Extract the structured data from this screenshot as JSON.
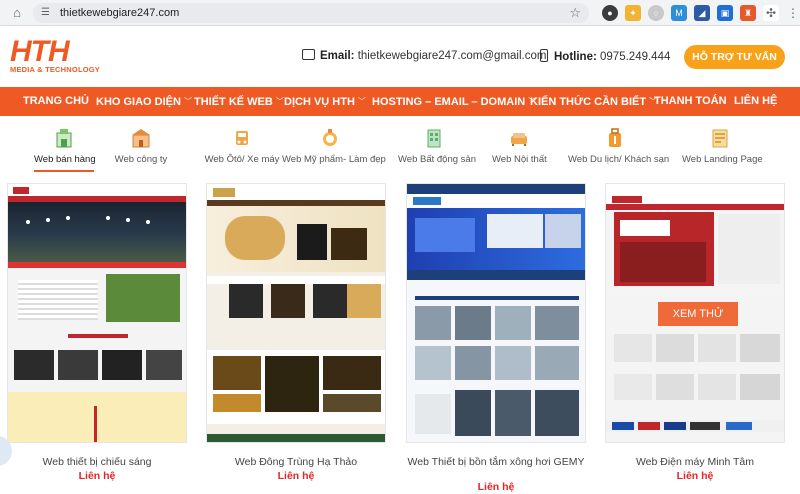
{
  "browser": {
    "url": "thietkewebgiare247.com"
  },
  "header": {
    "logo_text": "HTH",
    "logo_sub": "MEDIA & TECHNOLOGY",
    "email_label": "Email:",
    "email_value": "thietkewebgiare247.com@gmail.com",
    "hotline_label": "Hotline:",
    "hotline_value": "0975.249.444",
    "support_button": "HỖ TRỢ TƯ VẤN"
  },
  "nav": {
    "items": [
      {
        "label": "TRANG CHỦ"
      },
      {
        "label": "KHO GIAO DIỆN"
      },
      {
        "label": "THIẾT KẾ WEB"
      },
      {
        "label": "DỊCH VỤ HTH"
      },
      {
        "label": "HOSTING – EMAIL – DOMAIN"
      },
      {
        "label": "KIẾN THỨC CẦN BIẾT"
      },
      {
        "label": "THANH TOÁN"
      },
      {
        "label": "LIÊN HỆ"
      }
    ]
  },
  "categories": [
    {
      "label": "Web bán hàng",
      "icon": "shop-icon"
    },
    {
      "label": "Web công ty",
      "icon": "company-icon"
    },
    {
      "label": "Web Ôtô/ Xe máy",
      "icon": "car-icon"
    },
    {
      "label": "Web Mỹ phẩm- Làm đẹp",
      "icon": "cosmetics-icon"
    },
    {
      "label": "Web Bất động sản",
      "icon": "building-icon"
    },
    {
      "label": "Web Nội thất",
      "icon": "sofa-icon"
    },
    {
      "label": "Web Du lịch/ Khách sạn",
      "icon": "luggage-icon"
    },
    {
      "label": "Web Landing Page",
      "icon": "landing-page-icon"
    }
  ],
  "products": [
    {
      "title": "Web thiết bị chiếu sáng",
      "price": "Liên hệ"
    },
    {
      "title": "Web Đông Trùng Hạ Thảo",
      "price": "Liên hệ"
    },
    {
      "title": "Web Thiết bị bồn tắm xông hơi GEMY",
      "price": "Liên hệ"
    },
    {
      "title": "Web Điện máy Minh Tâm",
      "price": "Liên hệ",
      "overlay": "XEM THỬ"
    }
  ],
  "colors": {
    "brand": "#ef5a24",
    "support": "#f8a21a",
    "price": "#e3262a"
  }
}
